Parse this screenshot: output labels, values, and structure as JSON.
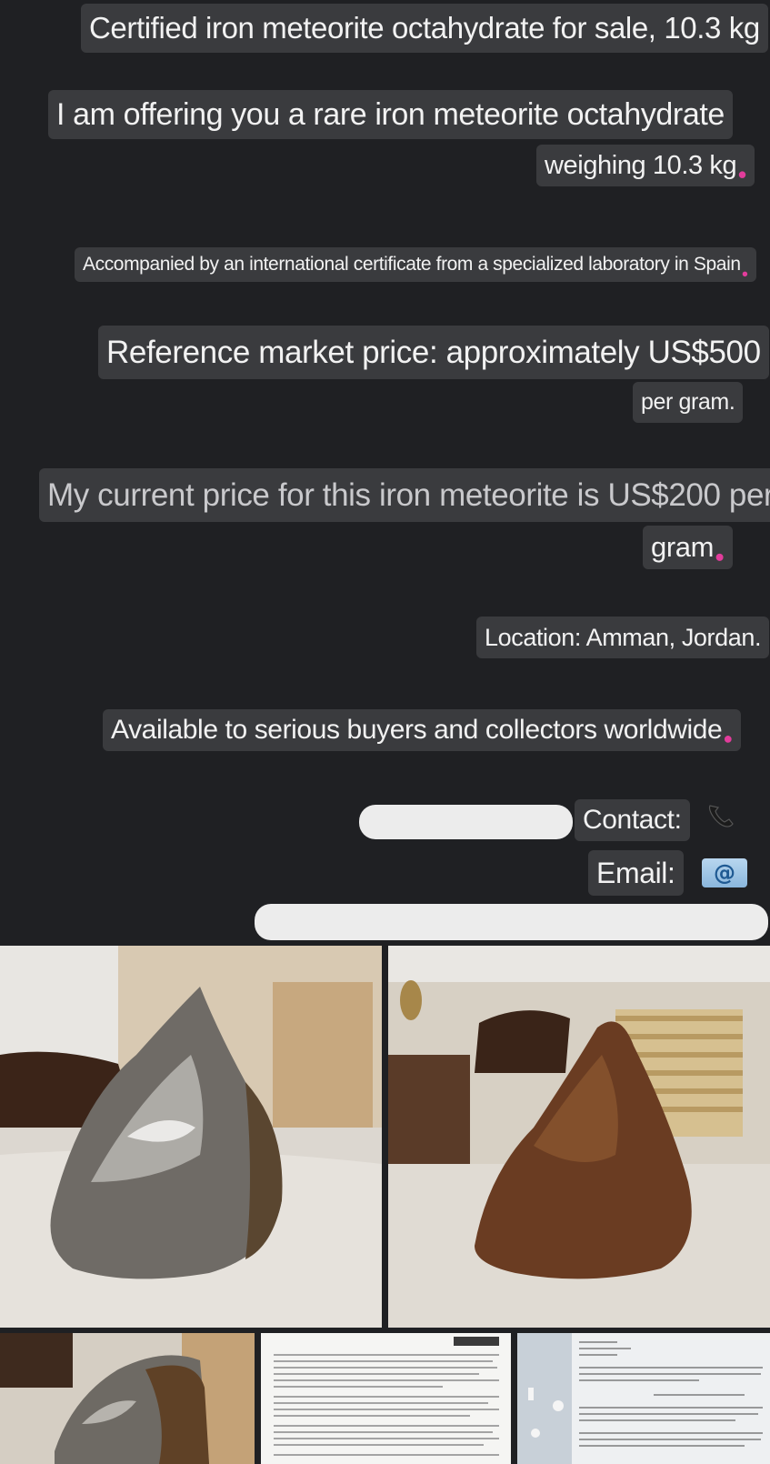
{
  "post": {
    "title": "Certified iron meteorite octahydrate for sale, 10.3 kg",
    "offer_line1": "I am offering you a rare iron meteorite octahydrate",
    "offer_line2": "weighing 10.3 kg",
    "certificate": "Accompanied by an international certificate from a specialized laboratory in Spain",
    "reference_line1": "Reference market price: approximately US$500",
    "reference_line2": "per gram.",
    "current_line1": "My current price for this iron meteorite is US$200 per",
    "current_line2": "gram",
    "location": "Location: Amman, Jordan.",
    "availability": "Available to serious buyers and collectors worldwide",
    "contact_label": "Contact:",
    "email_label": "Email:",
    "at_symbol": "@"
  },
  "icons": {
    "phone": "telephone-receiver-icon",
    "email": "at-sign-icon"
  },
  "gallery": {
    "photos": [
      "meteorite-photo-metallic-side",
      "meteorite-photo-rusty-side",
      "meteorite-photo-closeup",
      "certificate-document-page-1",
      "certificate-document-page-2"
    ]
  },
  "colors": {
    "background": "#1f2023",
    "text_highlight": "#3a3b3e",
    "text": "#f2f2f2",
    "emoji_accent": "#e23c9b"
  }
}
